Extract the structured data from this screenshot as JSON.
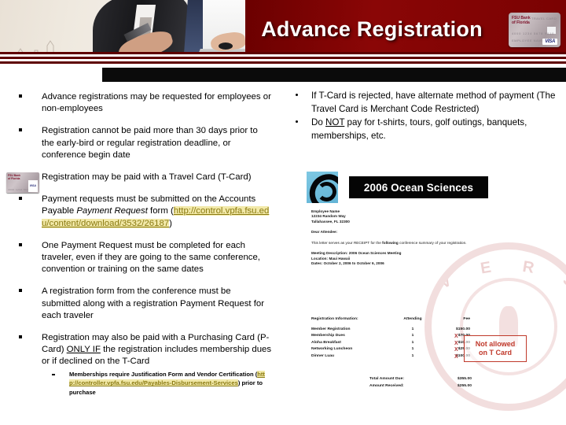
{
  "header": {
    "title": "Advance Registration",
    "card_image": {
      "bank_name": "FSU Bank",
      "bank_sub": "of Florida",
      "network_top": "TRAVEL CARD",
      "number": "4000 1234 5678 9010",
      "holder": "EMPLOYEE NAME",
      "network": "VISA"
    }
  },
  "left_column": {
    "bullets": [
      {
        "id": "advance-registrations",
        "text": "Advance registrations may be requested for employees or  non-employees",
        "marker": "square"
      },
      {
        "id": "thirty-days",
        "text": "Registration cannot be paid more than 30 days prior to the early-bird or regular registration deadline, or conference begin date",
        "marker": "square"
      },
      {
        "id": "travel-card",
        "text": "Registration may be paid with a Travel Card (T-Card)",
        "marker": "tcard-image"
      },
      {
        "id": "payment-request",
        "marker": "square",
        "text_before": "Payment requests must be submitted on the Accounts Payable ",
        "text_italic": "Payment Request",
        "text_mid": " form (",
        "link": "http://control.vpfa.fsu.edu/content/download/3532/26187",
        "text_after": ")"
      },
      {
        "id": "one-payment-request",
        "text": "One Payment Request must be completed for each traveler, even if they are going to the same conference, convention or training on the same dates",
        "marker": "square"
      },
      {
        "id": "registration-form",
        "text": "A registration form from the conference must be submitted along with a registration Payment Request for each traveler",
        "marker": "square"
      },
      {
        "id": "purchasing-card",
        "marker": "square",
        "text_before": "Registration may also be paid with a Purchasing Card (P-Card) ",
        "text_underline": "ONLY IF",
        "text_after": " the registration includes membership dues or if declined on the T-Card"
      }
    ],
    "sub_bullet": {
      "text_before": "Memberships require Justification Form and Vendor Certification (",
      "link": "http://controller.vpfa.fsu.edu/Payables-Disbursement-Services",
      "text_after": ") prior to purchase"
    }
  },
  "right_column": {
    "bullets": [
      {
        "id": "t-card-rejected",
        "text": "If T-Card is rejected, have alternate method of payment (The Travel Card is Merchant Code Restricted)"
      },
      {
        "id": "do-not-pay",
        "text_before": "Do ",
        "text_underline": "NOT",
        "text_after": " pay for t-shirts, tours, golf outings, banquets, memberships, etc."
      }
    ],
    "conference_logo": {
      "title": "2006 Ocean Sciences"
    },
    "receipt_letter": {
      "address": [
        "Employee Name",
        "12234 Random Way",
        "Tallahassee, FL 32300"
      ],
      "salutation": "Dear Attendee:",
      "body_before": "This letter serves as your RECEIPT for the ",
      "body_bold": "following",
      "body_after": " conference summary of your registration.",
      "meeting": [
        "Meeting Description:  2006 Ocean Sciences Meeting",
        "Location:  Maui Hawaii",
        "Dates:  October 2, 2006 to October 6, 2006"
      ],
      "table": {
        "headers": [
          "Registration Information:",
          "Attending",
          "Fee"
        ],
        "rows": [
          {
            "item": "Member Registration",
            "attending": "1",
            "fee": "$150.00",
            "flagged": false
          },
          {
            "item": "Membership Dues",
            "attending": "1",
            "fee": "$70.00",
            "flagged": true
          },
          {
            "item": "Aloha Breakfast",
            "attending": "1",
            "fee": "$10.00",
            "flagged": true
          },
          {
            "item": "Networking Luncheon",
            "attending": "1",
            "fee": "$25.00",
            "flagged": true
          },
          {
            "item": "Dinner Luau",
            "attending": "1",
            "fee": "$100.00",
            "flagged": true
          }
        ],
        "totals": [
          {
            "label": "Total Amount Due:",
            "value": "$355.00"
          },
          {
            "label": "Amount Received:",
            "value": "$255.00"
          }
        ]
      }
    },
    "annotation": {
      "line1": "Not allowed",
      "line2": "on T Card",
      "x_marks": "X",
      "color": "#c0392b"
    }
  },
  "watermark": {
    "text": "UNIVERSITY"
  },
  "theme": {
    "header_red": "#7a0202",
    "header_black": "#0b0b0b",
    "link_color": "#8a7a12",
    "link_highlight": "#f2e9a8",
    "annotation_red": "#c0392b"
  }
}
